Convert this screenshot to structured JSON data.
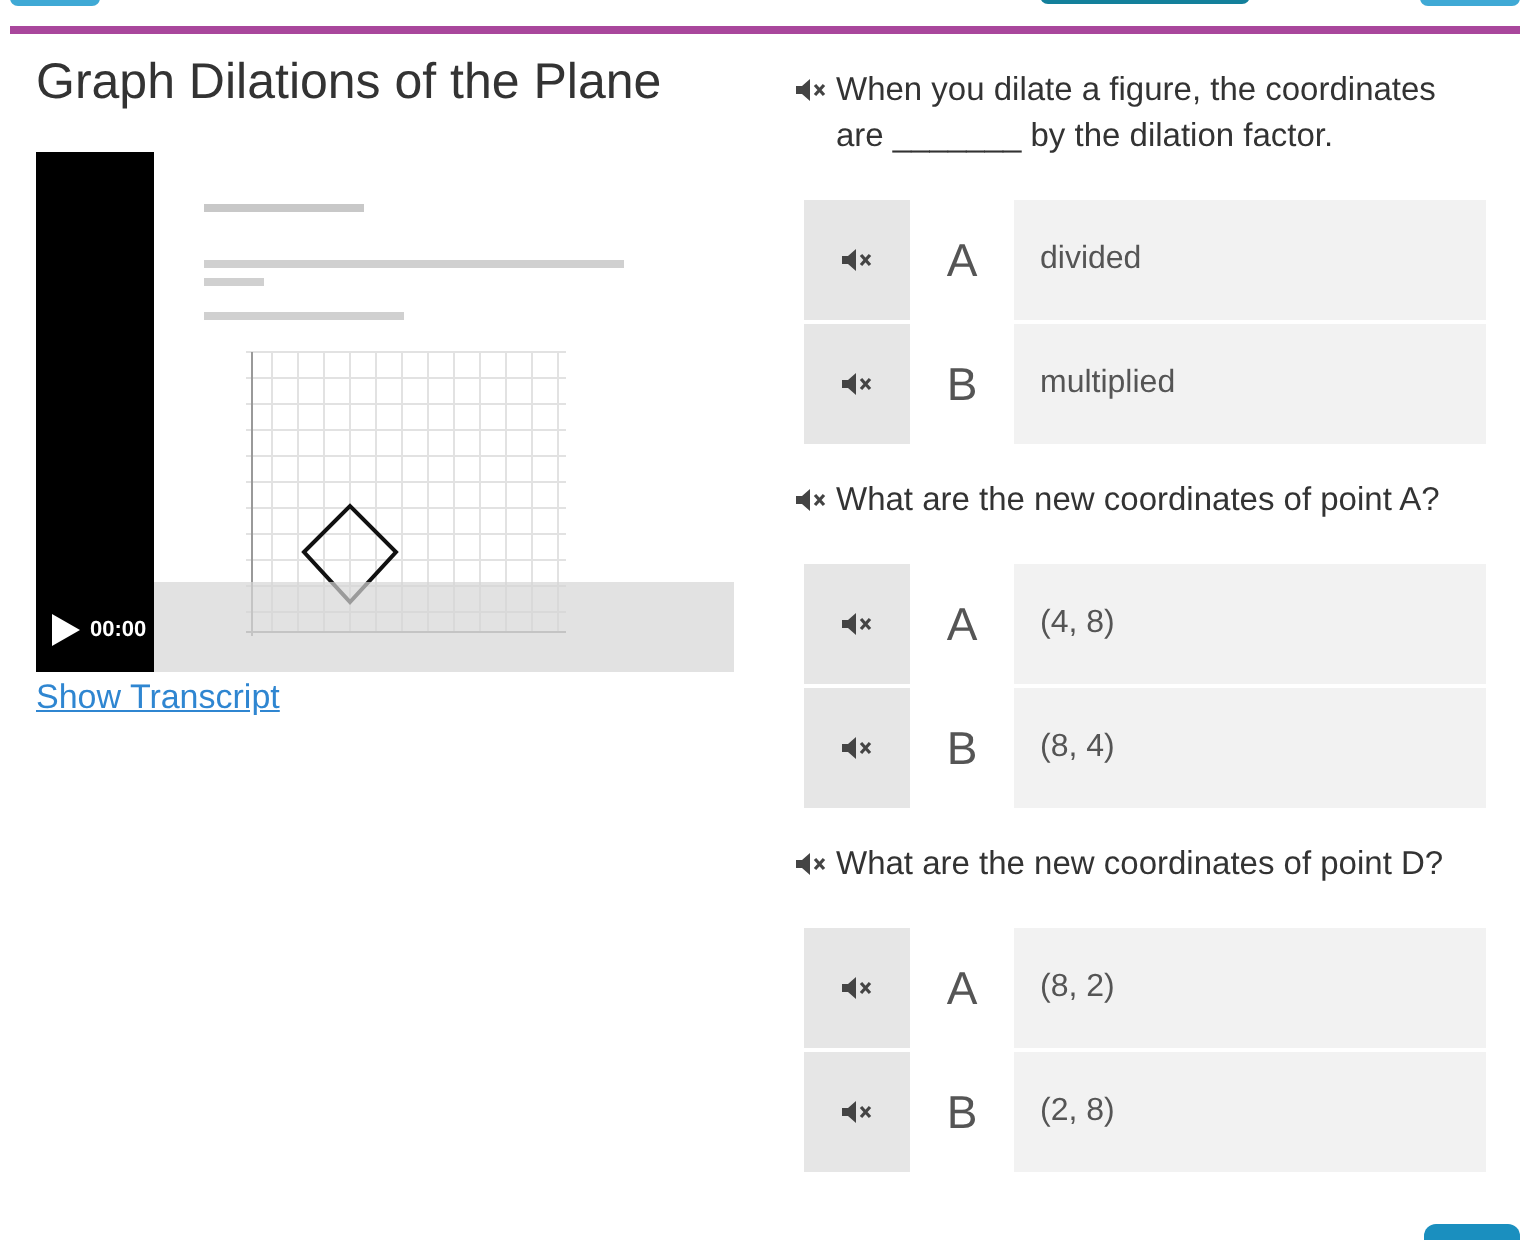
{
  "title": "Graph Dilations of the Plane",
  "video": {
    "time": "00:00"
  },
  "transcript_link": "Show Transcript",
  "questions": [
    {
      "prompt": "When you dilate a figure, the coordinates are _______ by the dilation factor.",
      "answers": [
        {
          "letter": "A",
          "text": "divided"
        },
        {
          "letter": "B",
          "text": "multiplied"
        }
      ]
    },
    {
      "prompt": "What are the new coordinates of point A?",
      "answers": [
        {
          "letter": "A",
          "text": "(4, 8)"
        },
        {
          "letter": "B",
          "text": "(8, 4)"
        }
      ]
    },
    {
      "prompt": "What are the new coordinates of point D?",
      "answers": [
        {
          "letter": "A",
          "text": "(8, 2)"
        },
        {
          "letter": "B",
          "text": "(2, 8)"
        }
      ]
    }
  ]
}
